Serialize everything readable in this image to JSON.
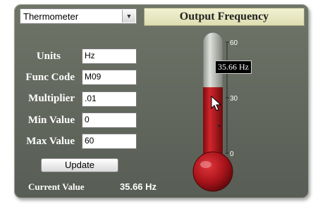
{
  "widget": {
    "type_select": {
      "selected": "Thermometer"
    },
    "title": "Output Frequency"
  },
  "form": {
    "units": {
      "label": "Units",
      "value": "Hz"
    },
    "func_code": {
      "label": "Func Code",
      "value": "M09"
    },
    "multiplier": {
      "label": "Multiplier",
      "value": ".01"
    },
    "min_value": {
      "label": "Min Value",
      "value": "0"
    },
    "max_value": {
      "label": "Max Value",
      "value": "60"
    }
  },
  "update_label": "Update",
  "current": {
    "label": "Current Value",
    "value": "35.66 Hz"
  },
  "gauge": {
    "min": 0,
    "max": 60,
    "value": 35.66,
    "ticks": [
      "60",
      "30",
      "0"
    ],
    "tooltip": "35.66 Hz",
    "fill_color": "#b3161b",
    "empty_color": "#aeb2ad"
  }
}
